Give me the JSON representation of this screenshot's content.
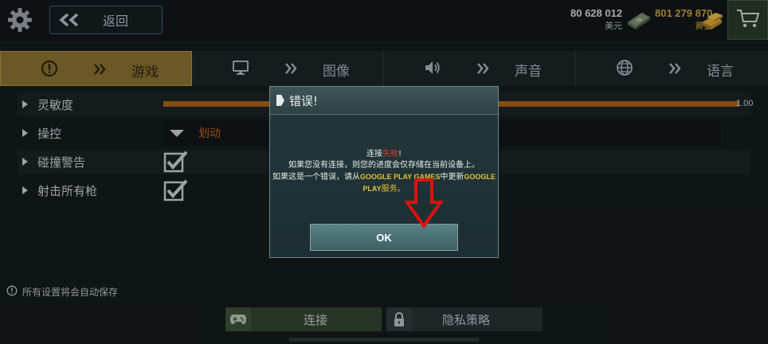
{
  "header": {
    "back_label": "返回",
    "cash": {
      "amount": "80 628 012",
      "label": "美元"
    },
    "gold": {
      "amount": "801 279 870",
      "label": "黄金"
    }
  },
  "tabs": [
    {
      "label": "游戏",
      "icon": "alert-circle-icon",
      "active": true
    },
    {
      "label": "图像",
      "icon": "monitor-icon",
      "active": false
    },
    {
      "label": "声音",
      "icon": "speaker-icon",
      "active": false
    },
    {
      "label": "语言",
      "icon": "globe-icon",
      "active": false
    }
  ],
  "settings": {
    "sensitivity": {
      "label": "灵敏度",
      "value_text": "1.00",
      "fill_fraction": 1.0
    },
    "controls": {
      "label": "操控",
      "value": "划动"
    },
    "collision_warning": {
      "label": "碰撞警告",
      "checked": true
    },
    "shoot_all_guns": {
      "label": "射击所有枪",
      "checked": true
    }
  },
  "footer": {
    "autosave_note": "所有设置将会自动保存",
    "connect_label": "连接",
    "privacy_label": "隐私策略"
  },
  "dialog": {
    "title": "错误!",
    "line1_prefix": "连接",
    "line1_fail": "失败",
    "line1_suffix": "!",
    "line2": "如果您没有连接，则您的进度会仅存储在当前设备上。",
    "line3_prefix": "如果这是一个错误，请从",
    "line3_games": "GOOGLE PLAY GAMES",
    "line3_mid": "中更新",
    "line3_services_a": "GOOGLE",
    "line4_services_b": "PLAY",
    "line4_suffix": "服务。",
    "ok_label": "OK"
  },
  "colors": {
    "accent_gold": "#8a7131",
    "slider_fill": "#a86418",
    "fail_red": "#e23a2a",
    "highlight_yellow": "#e0c236",
    "annotation_arrow": "#e01010"
  }
}
